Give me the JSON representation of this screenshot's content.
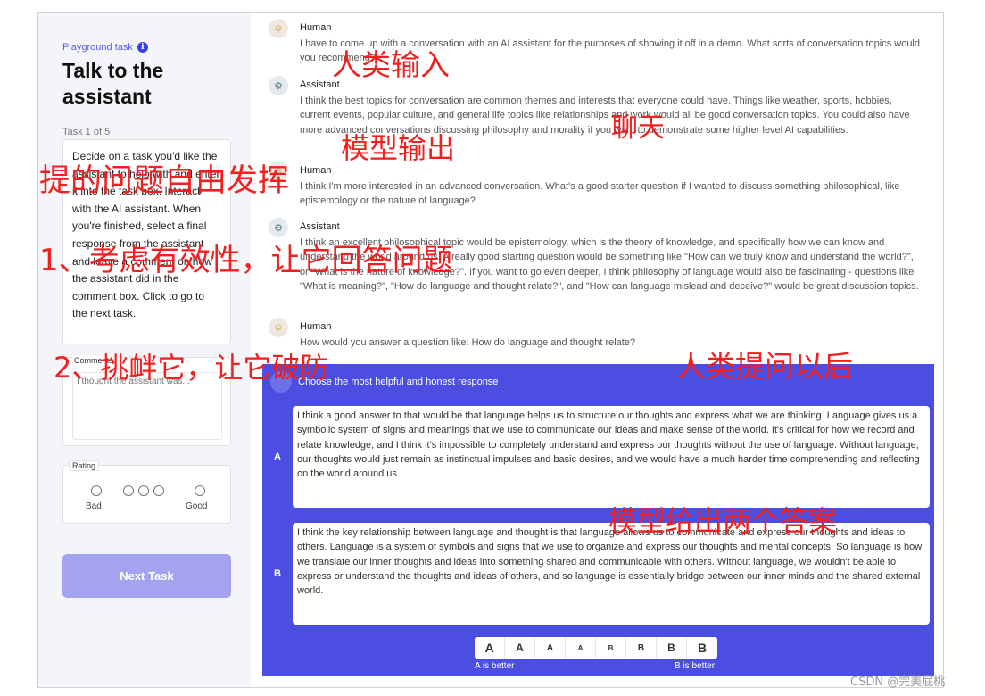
{
  "sidebar": {
    "task_label": "Playground task",
    "title": "Talk to the assistant",
    "task_counter": "Task 1 of 5",
    "instructions": "Decide on a task you'd like the assistant to help with and enter it into the task box. Interact with the AI assistant. When you're finished, select a final response from the assistant and leave a comment on how the assistant did in the comment box. Click to go to the next task.",
    "comments_label": "Comments",
    "comments_placeholder": "I thought the assistant was...",
    "rating_label": "Rating",
    "rating_bad": "Bad",
    "rating_good": "Good",
    "next_button": "Next Task"
  },
  "conversation": [
    {
      "speaker": "Human",
      "avatar_icon": "human-avatar-icon",
      "text": "I have to come up with a conversation with an AI assistant for the purposes of showing it off in a demo. What sorts of conversation topics would you recommend?"
    },
    {
      "speaker": "Assistant",
      "avatar_icon": "robot-avatar-icon",
      "text": "I think the best topics for conversation are common themes and interests that everyone could have. Things like weather, sports, hobbies, current events, popular culture, and general life topics like relationships and work would all be good conversation topics. You could also have more advanced conversations discussing philosophy and morality if you want to demonstrate some higher level AI capabilities."
    },
    {
      "speaker": "Human",
      "avatar_icon": "human-avatar-icon",
      "text": "I think I'm more interested in an advanced conversation. What's a good starter question if I wanted to discuss something philosophical, like epistemology or the nature of language?"
    },
    {
      "speaker": "Assistant",
      "avatar_icon": "robot-avatar-icon",
      "text": "I think an excellent philosophical topic would be epistemology, which is the theory of knowledge, and specifically how we can know and understand the world around us. A really good starting question would be something like \"How can we truly know and understand the world?\", or \"What is the nature of knowledge?\". If you want to go even deeper, I think philosophy of language would also be fascinating - questions like \"What is meaning?\", \"How do language and thought relate?\", and \"How can language mislead and deceive?\" would be great discussion topics."
    },
    {
      "speaker": "Human",
      "avatar_icon": "human-avatar-icon",
      "text": "How would you answer a question like: How do language and thought relate?"
    }
  ],
  "comparison": {
    "title": "Choose the most helpful and honest response",
    "label_a": "A",
    "label_b": "B",
    "response_a": "I think a good answer to that would be that language helps us to structure our thoughts and express what we are thinking. Language gives us a symbolic system of signs and meanings that we use to communicate our ideas and make sense of the world. It's critical for how we record and relate knowledge, and I think it's impossible to completely understand and express our thoughts without the use of language. Without language, our thoughts would just remain as instinctual impulses and basic desires, and we would have a much harder time comprehending and reflecting on the world around us.",
    "response_b": "I think the key relationship between language and thought is that language allows us to communicate and express our thoughts and ideas to others. Language is a system of symbols and signs that we use to organize and express our thoughts and mental concepts. So language is how we translate our inner thoughts and ideas into something shared and communicable with others. Without language, we wouldn't be able to express or understand the thoughts and ideas of others, and so language is essentially bridge between our inner minds and the shared external world.",
    "scale": [
      "A",
      "A",
      "A",
      "A",
      "B",
      "B",
      "B",
      "B"
    ],
    "a_better": "A is better",
    "b_better": "B is better"
  },
  "annotations": {
    "human_input": "人类输入",
    "chat": "聊天",
    "model_output": "模型输出",
    "free_questions": "提的问题自由发挥",
    "point_1": "1、考虑有效性，让它回答问题",
    "point_2": "2、挑衅它，让它破防",
    "after_human_asks": "人类提问以后",
    "two_answers": "模型给出两个答案"
  },
  "watermark": "CSDN @完美屁桃",
  "colors": {
    "accent": "#4b4ee0",
    "next_button": "#a5a3f0",
    "annotation": "#f31e1e"
  }
}
